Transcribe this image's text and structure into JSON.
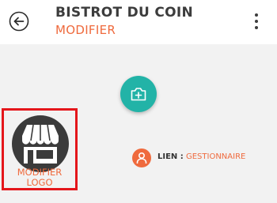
{
  "header": {
    "title": "BISTROT DU COIN",
    "subtitle": "MODIFIER",
    "back_icon": "arrow-left-circle-icon",
    "menu_icon": "more-vertical-icon"
  },
  "photo": {
    "icon": "camera-plus-icon"
  },
  "logo": {
    "icon": "storefront-icon",
    "label_line1": "MODIFIER",
    "label_line2": "LOGO"
  },
  "lien": {
    "icon": "user-icon",
    "label": "LIEN :",
    "value": "GESTIONNAIRE"
  },
  "colors": {
    "accent": "#ef6a3d",
    "teal": "#22b3a7",
    "highlight": "#e4161b",
    "dark": "#3c3c3c"
  }
}
